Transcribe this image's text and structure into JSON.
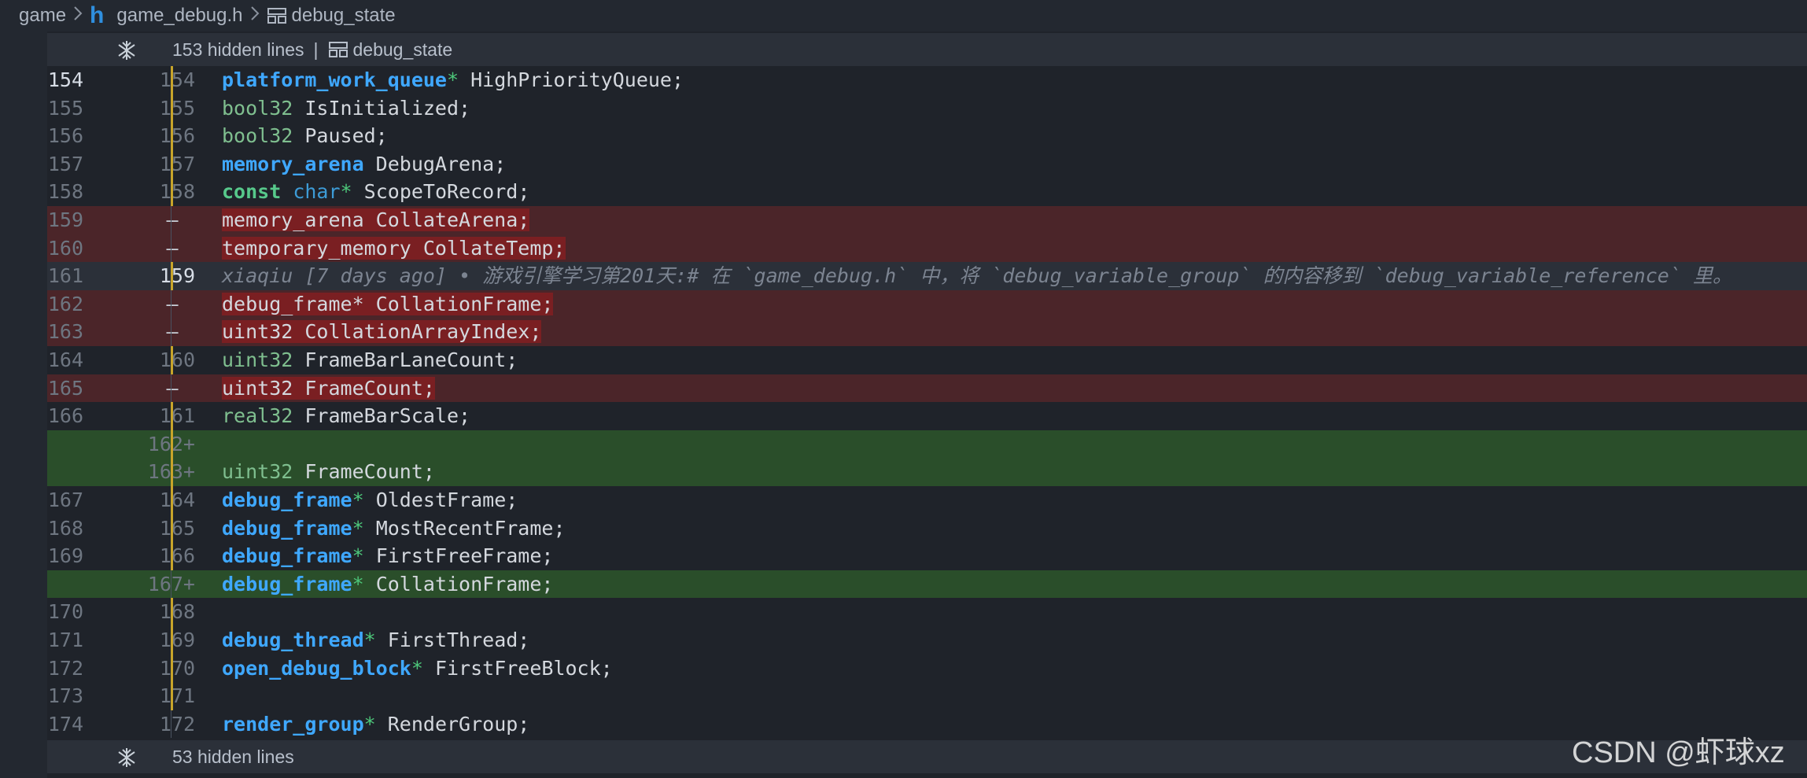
{
  "breadcrumb": {
    "folder": "game",
    "file_icon": "h",
    "file": "game_debug.h",
    "symbol": "debug_state"
  },
  "hidden_top": {
    "text": "153 hidden lines",
    "symbol": "debug_state"
  },
  "hidden_bottom": {
    "text": "53 hidden lines"
  },
  "lines": [
    {
      "old": "154",
      "new": "154",
      "kind": "context",
      "tokens": [
        [
          "platform_work_queue",
          "t"
        ],
        [
          "*",
          "s"
        ],
        [
          " HighPriorityQueue;",
          ""
        ]
      ]
    },
    {
      "old": "155",
      "new": "155",
      "kind": "context",
      "tokens": [
        [
          "bool32",
          "g"
        ],
        [
          " IsInitialized;",
          ""
        ]
      ]
    },
    {
      "old": "156",
      "new": "156",
      "kind": "context",
      "tokens": [
        [
          "bool32",
          "g"
        ],
        [
          " Paused;",
          ""
        ]
      ]
    },
    {
      "old": "157",
      "new": "157",
      "kind": "context",
      "tokens": [
        [
          "memory_arena",
          "t"
        ],
        [
          " DebugArena;",
          ""
        ]
      ]
    },
    {
      "old": "158",
      "new": "158",
      "kind": "context",
      "tokens": [
        [
          "const",
          "const"
        ],
        [
          " ",
          ""
        ],
        [
          "char",
          "c"
        ],
        [
          "*",
          "s"
        ],
        [
          " ScopeToRecord;",
          ""
        ]
      ]
    },
    {
      "old": "159",
      "new": "—",
      "kind": "removed",
      "text": "memory_arena CollateArena;"
    },
    {
      "old": "160",
      "new": "—",
      "kind": "removed",
      "text": "temporary_memory CollateTemp;"
    },
    {
      "old": "161",
      "new": "159",
      "kind": "blame",
      "text": "xiaqiu [7 days ago] • 游戏引擎学习第201天:# 在 `game_debug.h` 中，将 `debug_variable_group` 的内容移到 `debug_variable_reference` 里。"
    },
    {
      "old": "162",
      "new": "—",
      "kind": "removed",
      "text": "debug_frame* CollationFrame;"
    },
    {
      "old": "163",
      "new": "—",
      "kind": "removed",
      "text": "uint32 CollationArrayIndex;"
    },
    {
      "old": "164",
      "new": "160",
      "kind": "context",
      "tokens": [
        [
          "uint32",
          "g"
        ],
        [
          " FrameBarLaneCount;",
          ""
        ]
      ]
    },
    {
      "old": "165",
      "new": "—",
      "kind": "removed",
      "text": "uint32 FrameCount;"
    },
    {
      "old": "166",
      "new": "161",
      "kind": "context",
      "tokens": [
        [
          "real32",
          "g"
        ],
        [
          " FrameBarScale;",
          ""
        ]
      ]
    },
    {
      "old": "",
      "new": "162",
      "kind": "added",
      "tokens": []
    },
    {
      "old": "",
      "new": "163",
      "kind": "added",
      "tokens": [
        [
          "uint32",
          "g"
        ],
        [
          " FrameCount;",
          ""
        ]
      ]
    },
    {
      "old": "167",
      "new": "164",
      "kind": "context",
      "tokens": [
        [
          "debug_frame",
          "t"
        ],
        [
          "*",
          "s"
        ],
        [
          " OldestFrame;",
          ""
        ]
      ]
    },
    {
      "old": "168",
      "new": "165",
      "kind": "context",
      "tokens": [
        [
          "debug_frame",
          "t"
        ],
        [
          "*",
          "s"
        ],
        [
          " MostRecentFrame;",
          ""
        ]
      ]
    },
    {
      "old": "169",
      "new": "166",
      "kind": "context",
      "tokens": [
        [
          "debug_frame",
          "t"
        ],
        [
          "*",
          "s"
        ],
        [
          " FirstFreeFrame;",
          ""
        ]
      ]
    },
    {
      "old": "",
      "new": "167",
      "kind": "added",
      "tokens": [
        [
          "debug_frame",
          "t"
        ],
        [
          "*",
          "s"
        ],
        [
          " CollationFrame;",
          ""
        ]
      ]
    },
    {
      "old": "170",
      "new": "168",
      "kind": "context",
      "tokens": []
    },
    {
      "old": "171",
      "new": "169",
      "kind": "context",
      "tokens": [
        [
          "debug_thread",
          "t"
        ],
        [
          "*",
          "s"
        ],
        [
          " FirstThread;",
          ""
        ]
      ]
    },
    {
      "old": "172",
      "new": "170",
      "kind": "context",
      "tokens": [
        [
          "open_debug_block",
          "t"
        ],
        [
          "*",
          "s"
        ],
        [
          " FirstFreeBlock;",
          ""
        ]
      ]
    },
    {
      "old": "173",
      "new": "171",
      "kind": "context",
      "tokens": []
    },
    {
      "old": "174",
      "new": "172",
      "kind": "context",
      "tokens": [
        [
          "render_group",
          "t"
        ],
        [
          "*",
          "s"
        ],
        [
          " RenderGroup;",
          ""
        ]
      ]
    }
  ],
  "active_old": "154",
  "active_new": "159",
  "watermark": "CSDN @虾球xz",
  "colors": {
    "background": "#1f232a",
    "removed_row": "#4b2529",
    "added_row": "#2a4e2a",
    "type_keyword": "#3fa8ff",
    "blame_marker": "#c8a52a"
  },
  "icons": [
    "chevron-right-icon",
    "h-file-icon",
    "struct-icon",
    "expand-lines-icon"
  ]
}
